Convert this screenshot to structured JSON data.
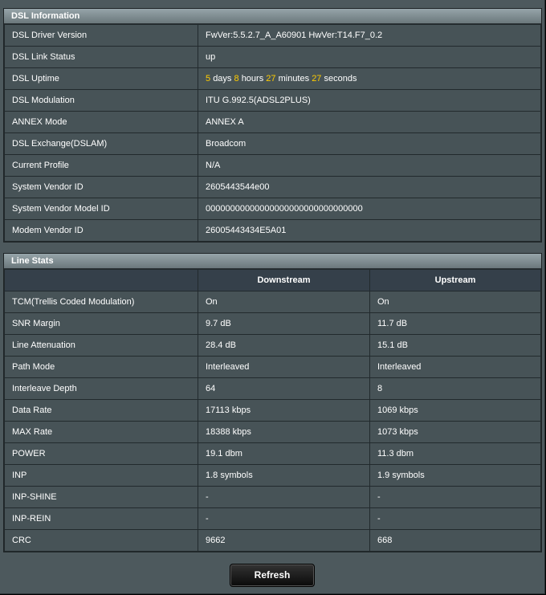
{
  "dsl_info": {
    "title": "DSL Information",
    "rows": [
      {
        "label": "DSL Driver Version",
        "value": "FwVer:5.5.2.7_A_A60901 HwVer:T14.F7_0.2"
      },
      {
        "label": "DSL Link Status",
        "value": "up"
      },
      {
        "label": "DSL Uptime"
      },
      {
        "label": "DSL Modulation",
        "value": "ITU G.992.5(ADSL2PLUS)"
      },
      {
        "label": "ANNEX Mode",
        "value": "ANNEX A"
      },
      {
        "label": "DSL Exchange(DSLAM)",
        "value": "Broadcom"
      },
      {
        "label": "Current Profile",
        "value": "N/A"
      },
      {
        "label": "System Vendor ID",
        "value": "2605443544e00"
      },
      {
        "label": "System Vendor Model ID",
        "value": "00000000000000000000000000000000"
      },
      {
        "label": "Modem Vendor ID",
        "value": "26005443434E5A01"
      }
    ],
    "uptime": {
      "days": "5",
      "days_unit": "days",
      "hours": "8",
      "hours_unit": "hours",
      "minutes": "27",
      "minutes_unit": "minutes",
      "seconds": "27",
      "seconds_unit": "seconds"
    }
  },
  "line_stats": {
    "title": "Line Stats",
    "col_downstream": "Downstream",
    "col_upstream": "Upstream",
    "rows": [
      {
        "label": "TCM(Trellis Coded Modulation)",
        "down": "On",
        "up": "On"
      },
      {
        "label": "SNR Margin",
        "down": "9.7 dB",
        "up": "11.7 dB"
      },
      {
        "label": "Line Attenuation",
        "down": "28.4 dB",
        "up": "15.1 dB"
      },
      {
        "label": "Path Mode",
        "down": "Interleaved",
        "up": "Interleaved"
      },
      {
        "label": "Interleave Depth",
        "down": "64",
        "up": "8"
      },
      {
        "label": "Data Rate",
        "down": "17113 kbps",
        "up": "1069 kbps"
      },
      {
        "label": "MAX Rate",
        "down": "18388 kbps",
        "up": "1073 kbps"
      },
      {
        "label": "POWER",
        "down": "19.1 dbm",
        "up": "11.3 dbm"
      },
      {
        "label": "INP",
        "down": "1.8 symbols",
        "up": "1.9 symbols"
      },
      {
        "label": "INP-SHINE",
        "down": "-",
        "up": "-"
      },
      {
        "label": "INP-REIN",
        "down": "-",
        "up": "-"
      },
      {
        "label": "CRC",
        "down": "9662",
        "up": "668"
      }
    ]
  },
  "refresh_label": "Refresh",
  "colors": {
    "highlight": "#ffcc00",
    "panel": "#4d595d"
  }
}
